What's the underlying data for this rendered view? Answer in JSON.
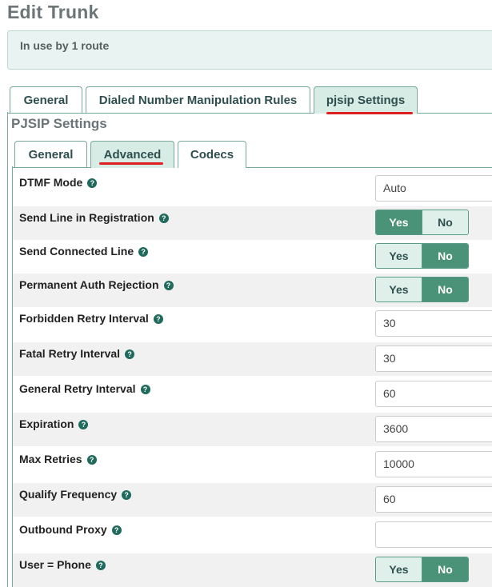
{
  "page": {
    "title": "Edit Trunk"
  },
  "info": {
    "text": "In use by 1 route"
  },
  "main_tabs": [
    {
      "label": "General",
      "active": false
    },
    {
      "label": "Dialed Number Manipulation Rules",
      "active": false
    },
    {
      "label": "pjsip Settings",
      "active": true
    }
  ],
  "section": {
    "title": "PJSIP Settings"
  },
  "sub_tabs": [
    {
      "label": "General",
      "active": false
    },
    {
      "label": "Advanced",
      "active": true
    },
    {
      "label": "Codecs",
      "active": false
    }
  ],
  "toggle_labels": {
    "yes": "Yes",
    "no": "No"
  },
  "fields": {
    "dtmf_mode": {
      "label": "DTMF Mode",
      "value": "Auto"
    },
    "send_line_in_registration": {
      "label": "Send Line in Registration",
      "value": "Yes"
    },
    "send_connected_line": {
      "label": "Send Connected Line",
      "value": "No"
    },
    "permanent_auth_rejection": {
      "label": "Permanent Auth Rejection",
      "value": "No"
    },
    "forbidden_retry_interval": {
      "label": "Forbidden Retry Interval",
      "value": "30"
    },
    "fatal_retry_interval": {
      "label": "Fatal Retry Interval",
      "value": "30"
    },
    "general_retry_interval": {
      "label": "General Retry Interval",
      "value": "60"
    },
    "expiration": {
      "label": "Expiration",
      "value": "3600"
    },
    "max_retries": {
      "label": "Max Retries",
      "value": "10000"
    },
    "qualify_frequency": {
      "label": "Qualify Frequency",
      "value": "60"
    },
    "outbound_proxy": {
      "label": "Outbound Proxy",
      "value": ""
    },
    "user_eq_phone": {
      "label": "User = Phone",
      "value": "No"
    }
  },
  "icons": {
    "help": "help-circle-icon"
  },
  "colors": {
    "accent": "#4a9379",
    "annotation": "#e02020",
    "active_tab": "#d7ece5"
  }
}
